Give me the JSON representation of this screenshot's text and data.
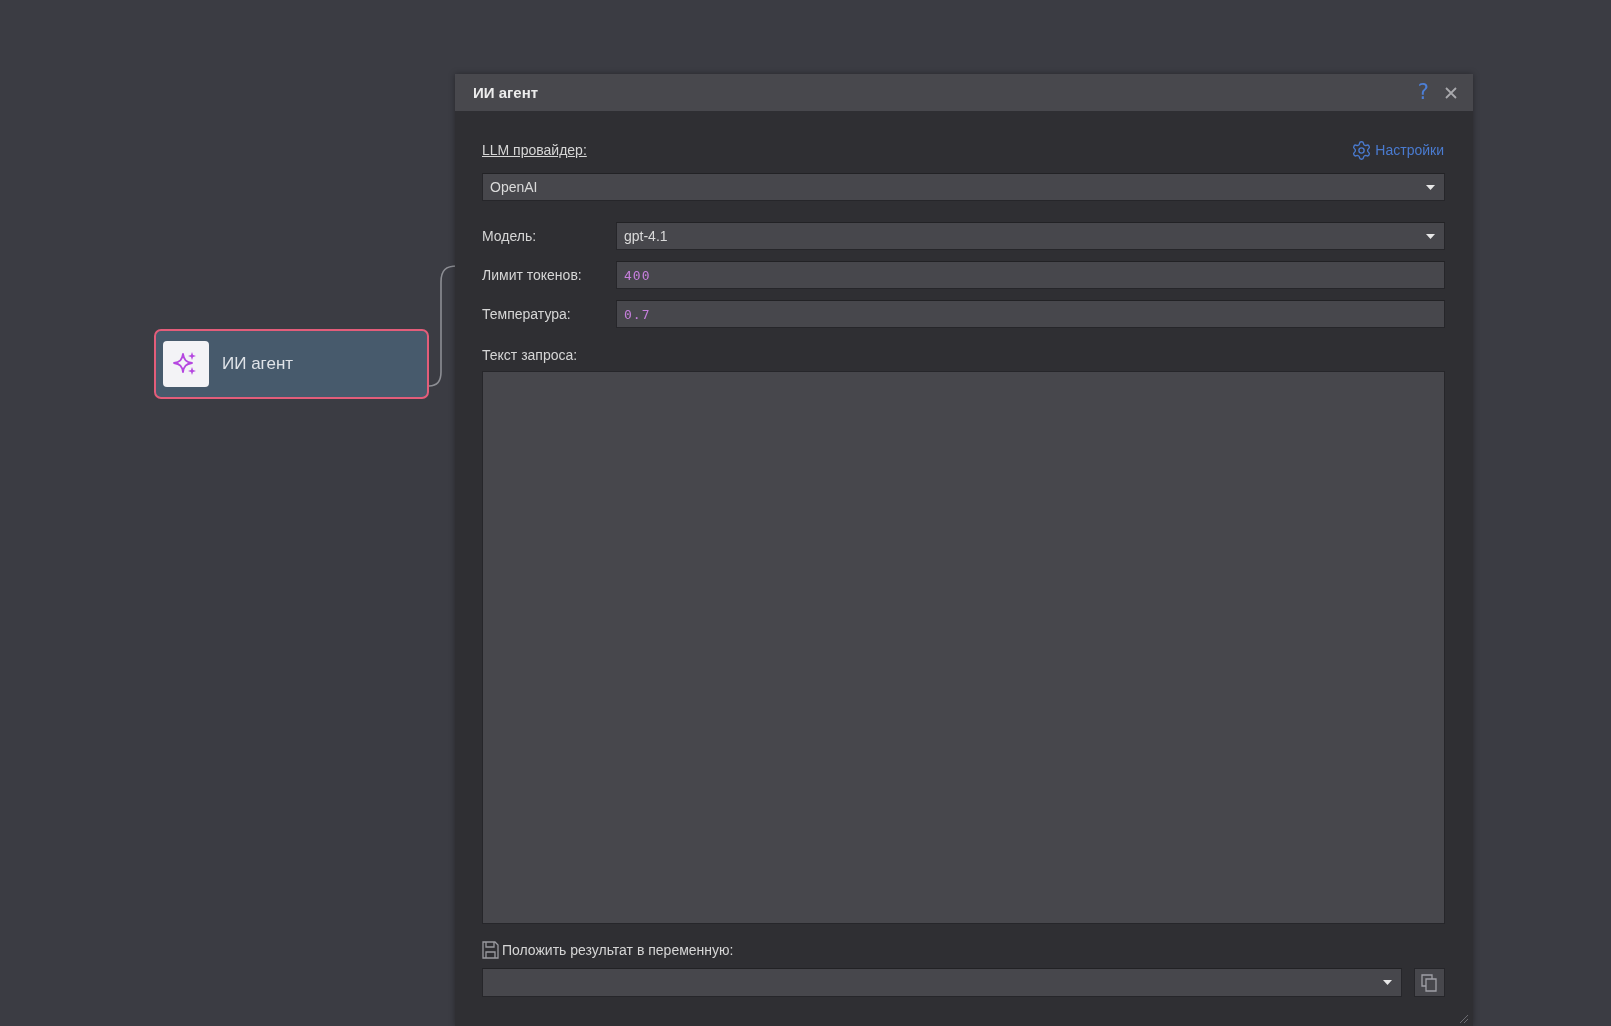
{
  "canvas": {
    "node": {
      "title": "ИИ агент",
      "selected": true
    }
  },
  "dialog": {
    "title": "ИИ агент",
    "help_button": "?",
    "provider": {
      "label": "LLM провайдер:",
      "settings_link": "Настройки",
      "value": "OpenAI"
    },
    "fields": [
      {
        "kind": "dropdown",
        "label": "Модель:",
        "value": "gpt-4.1"
      },
      {
        "kind": "input",
        "label": "Лимит токенов:",
        "value": "400"
      },
      {
        "kind": "input",
        "label": "Температура:",
        "value": "0.7"
      }
    ],
    "prompt": {
      "label": "Текст запроса:"
    },
    "result": {
      "label": "Положить результат в переменную:"
    }
  }
}
